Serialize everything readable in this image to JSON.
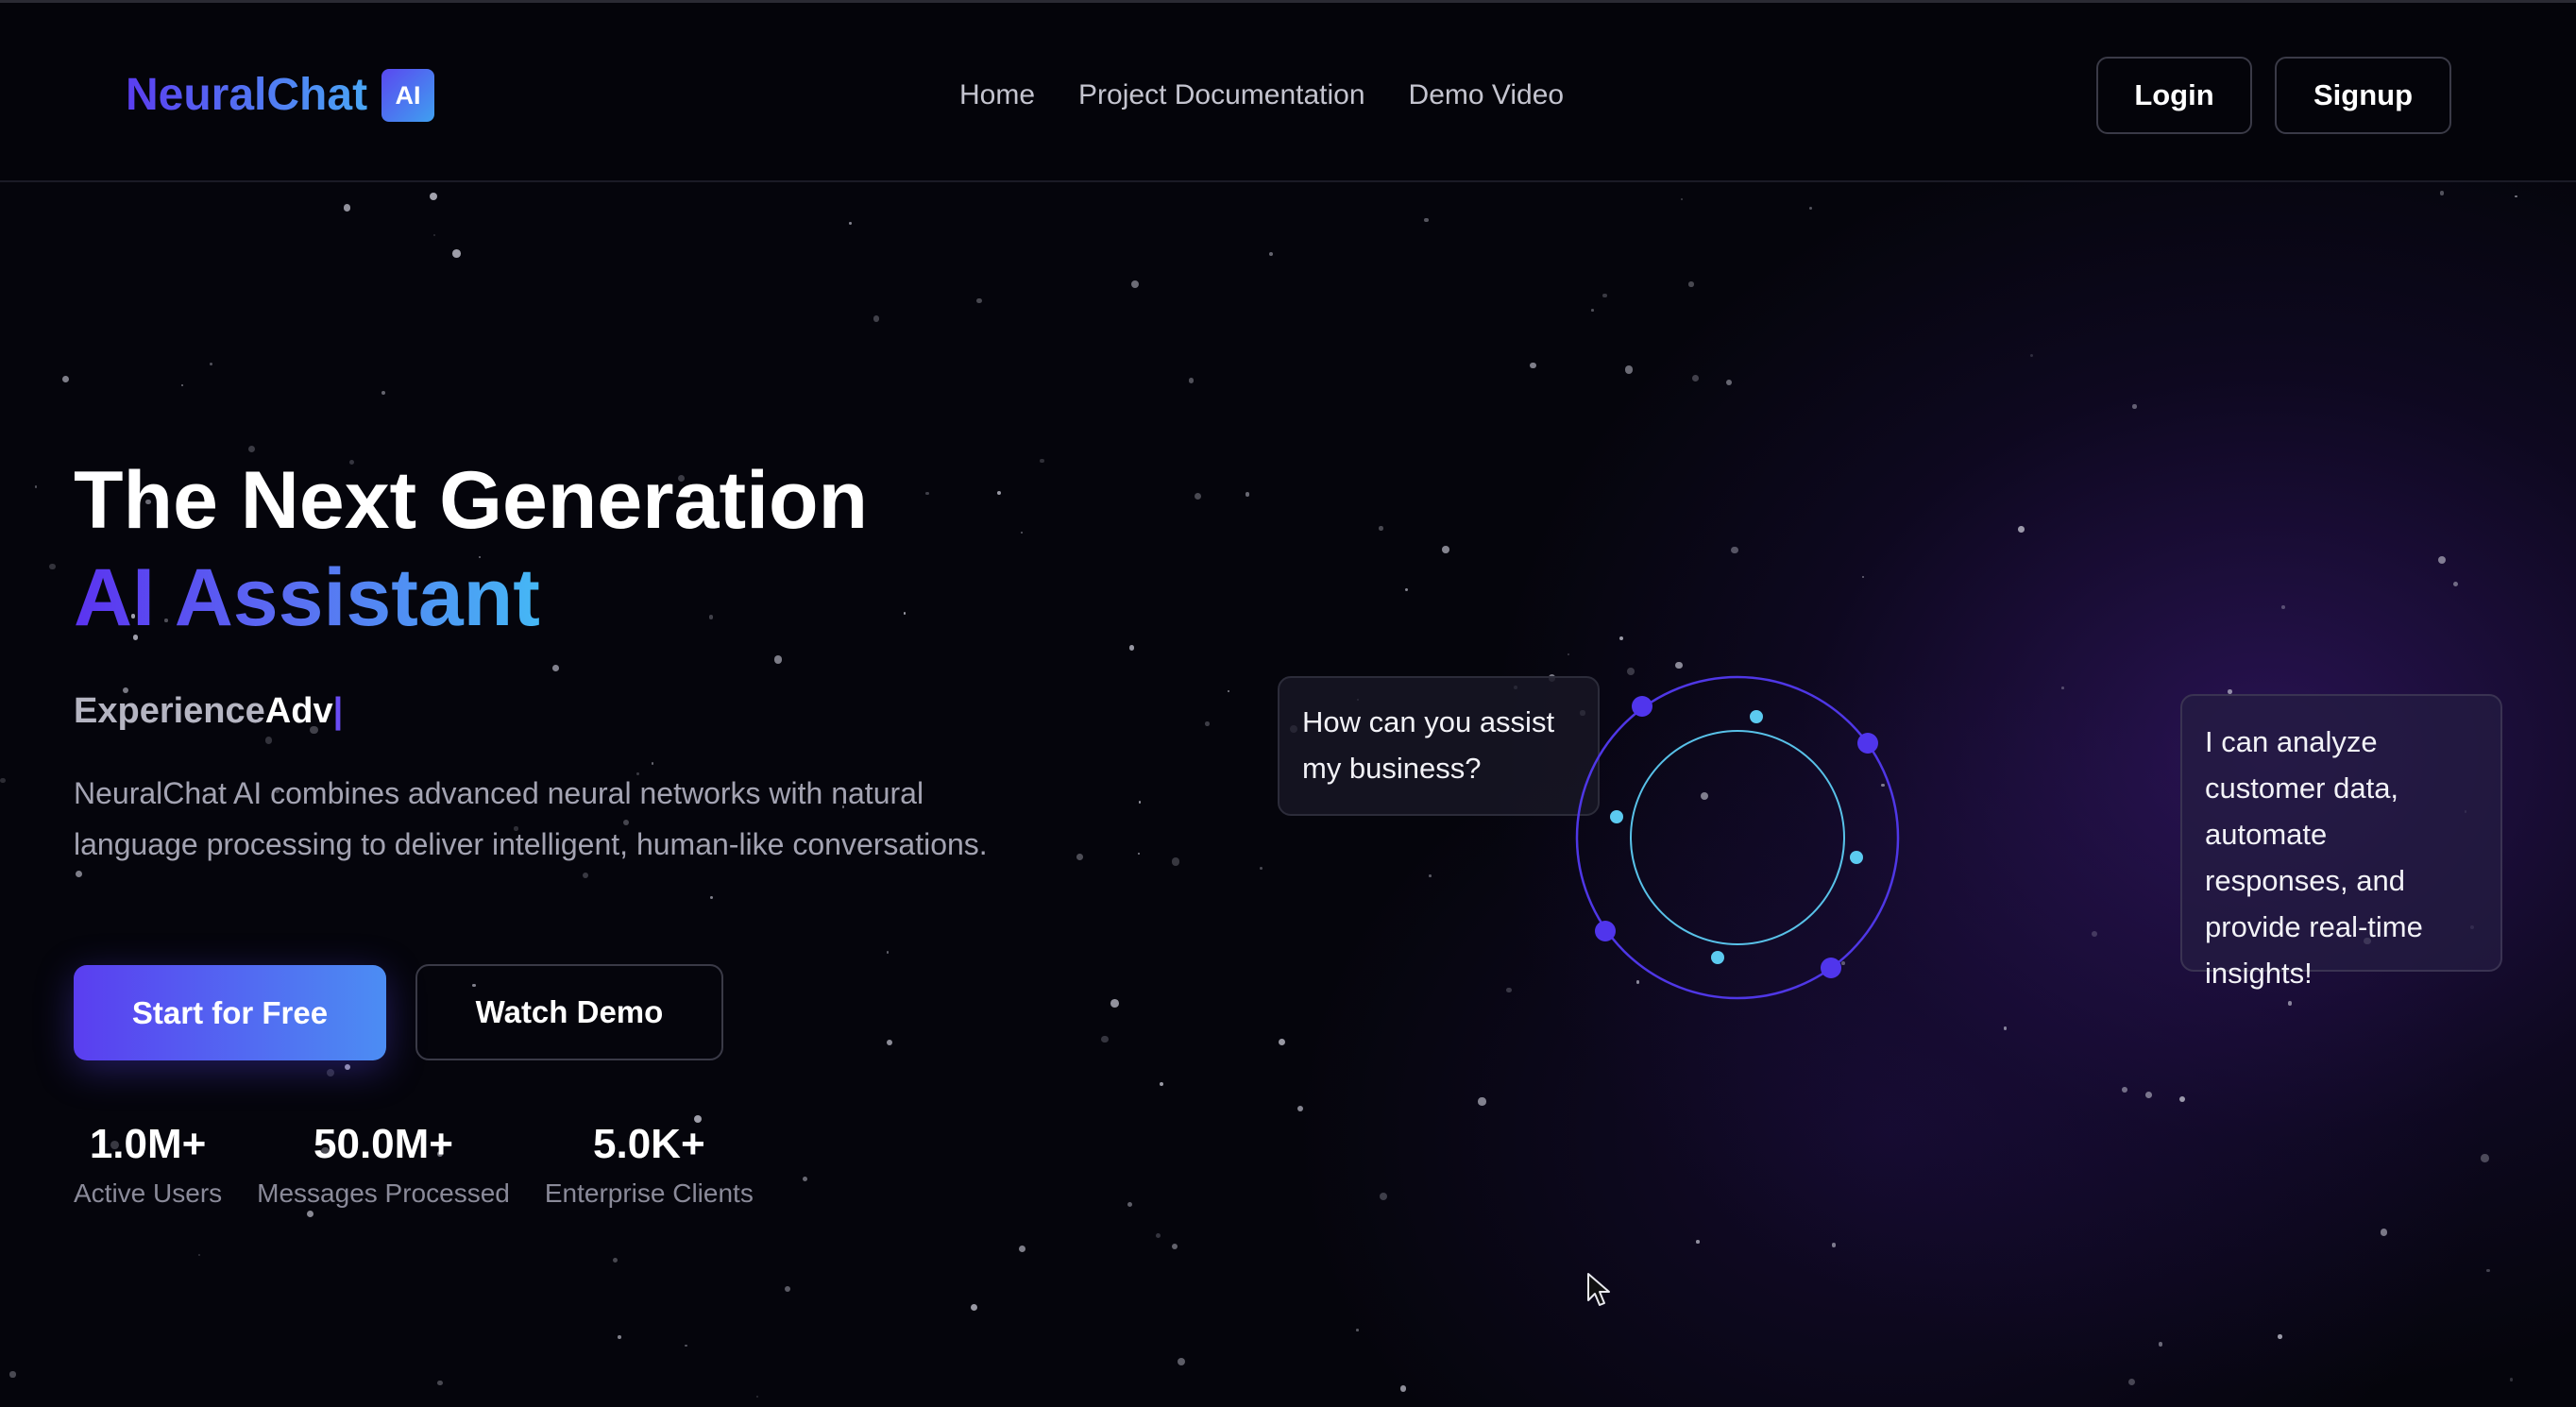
{
  "header": {
    "logo_text": "NeuralChat",
    "logo_badge": "AI",
    "nav": [
      {
        "label": "Home"
      },
      {
        "label": "Project Documentation"
      },
      {
        "label": "Demo Video"
      }
    ],
    "login_label": "Login",
    "signup_label": "Signup"
  },
  "hero": {
    "title_line1": "The Next Generation",
    "title_line2": "AI Assistant",
    "typing_prefix": "Experience",
    "typing_partial": "Adv",
    "typing_cursor": "|",
    "description": "NeuralChat AI combines advanced neural networks with natural language processing to deliver intelligent, human-like conversations.",
    "primary_cta": "Start for Free",
    "secondary_cta": "Watch Demo"
  },
  "stats": [
    {
      "value": "1.0M+",
      "label": "Active Users"
    },
    {
      "value": "50.0M+",
      "label": "Messages Processed"
    },
    {
      "value": "5.0K+",
      "label": "Enterprise Clients"
    }
  ],
  "chat_demo": {
    "user_message": "How can you assist my business?",
    "ai_message": "I can analyze customer data, automate responses, and provide real-time insights!"
  },
  "colors": {
    "accent_purple": "#5a3ef0",
    "accent_blue": "#45b8f5",
    "background": "#05050c"
  }
}
